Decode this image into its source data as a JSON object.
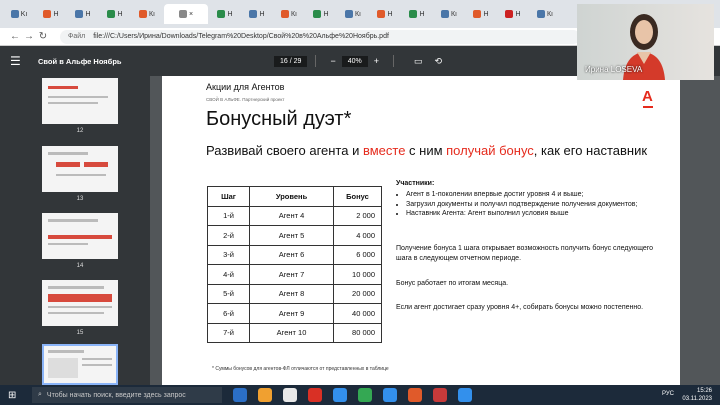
{
  "browser": {
    "tabs": [
      {
        "label": "Kı",
        "color": "#4a76a8"
      },
      {
        "label": "Н",
        "color": "#e05a2a"
      },
      {
        "label": "Н",
        "color": "#4a76a8"
      },
      {
        "label": "Н",
        "color": "#2a8c4a"
      },
      {
        "label": "Кı",
        "color": "#e05a2a"
      },
      {
        "label": "×",
        "color": "#888888",
        "active": true
      },
      {
        "label": "Н",
        "color": "#2a8c4a"
      },
      {
        "label": "Н",
        "color": "#4a76a8"
      },
      {
        "label": "Кı",
        "color": "#e05a2a"
      },
      {
        "label": "Н",
        "color": "#2a8c4a"
      },
      {
        "label": "Кı",
        "color": "#4a76a8"
      },
      {
        "label": "Н",
        "color": "#e05a2a"
      },
      {
        "label": "Н",
        "color": "#2a8c4a"
      },
      {
        "label": "Кı",
        "color": "#4a76a8"
      },
      {
        "label": "Н",
        "color": "#e05a2a"
      },
      {
        "label": "Н",
        "color": "#cc2222"
      },
      {
        "label": "Кı",
        "color": "#4a76a8"
      }
    ],
    "url_label": "Файл",
    "url": "file:///C:/Users/Ирина/Downloads/Telegram%20Desktop/Свой%20в%20Альфе%20Ноябрь.pdf"
  },
  "pdf_toolbar": {
    "title": "Свой в Альфе Ноябрь",
    "page_current": "16",
    "page_total": "29",
    "zoom": "40%",
    "icons": [
      "menu-icon",
      "zoom-out-icon",
      "zoom-in-icon",
      "fit-page-icon",
      "rotate-icon"
    ]
  },
  "thumbnails": [
    {
      "number": "12"
    },
    {
      "number": "13"
    },
    {
      "number": "14"
    },
    {
      "number": "15"
    },
    {
      "number": ""
    }
  ],
  "slide": {
    "heading": "Акции для Агентов",
    "subheading": "СВОЙ В АЛЬФЕ. Партнерский проект",
    "logo": "А",
    "title": "Бонусный дуэт*",
    "lead_part1": "Развивай своего агента и ",
    "lead_red1": "вместе",
    "lead_part2": " с ним ",
    "lead_red2": "получай бонус",
    "lead_part3": ", как его наставник",
    "table": {
      "headers": [
        "Шаг",
        "Уровень",
        "Бонус"
      ],
      "rows": [
        [
          "1-й",
          "Агент 4",
          "2 000"
        ],
        [
          "2-й",
          "Агент 5",
          "4 000"
        ],
        [
          "3-й",
          "Агент 6",
          "6 000"
        ],
        [
          "4-й",
          "Агент 7",
          "10 000"
        ],
        [
          "5-й",
          "Агент 8",
          "20 000"
        ],
        [
          "6-й",
          "Агент 9",
          "40 000"
        ],
        [
          "7-й",
          "Агент 10",
          "80 000"
        ]
      ]
    },
    "participants_title": "Участники:",
    "participants": [
      "Агент в 1-поколении впервые достиг уровня 4 и выше;",
      "Загрузил документы и получил подтверждение получения документов;",
      "Наставник Агента: Агент выполнил условия выше"
    ],
    "para1": "Получение бонуса 1 шага открывает возможность получить бонус следующего шага в следующем отчетном периоде.",
    "para2": "Бонус работает по итогам месяца.",
    "para3": "Если агент достигает сразу уровня 4+, собирать бонусы можно постепенно.",
    "footnote": "* Суммы бонусов для агентов-ФЛ отличаются от представленных в таблице"
  },
  "webcam": {
    "name": "Ирина LOSEVA"
  },
  "taskbar": {
    "search_placeholder": "Чтобы начать поиск, введите здесь запрос",
    "apps": [
      "#2b6fc7",
      "#f0a030",
      "#e8e8e8",
      "#d93025",
      "#3390ec",
      "#34a853",
      "#3390ec",
      "#e05a2a",
      "#c83a3a",
      "#3390ec"
    ],
    "language": "РУС",
    "time": "15:26",
    "date": "03.11.2023"
  }
}
